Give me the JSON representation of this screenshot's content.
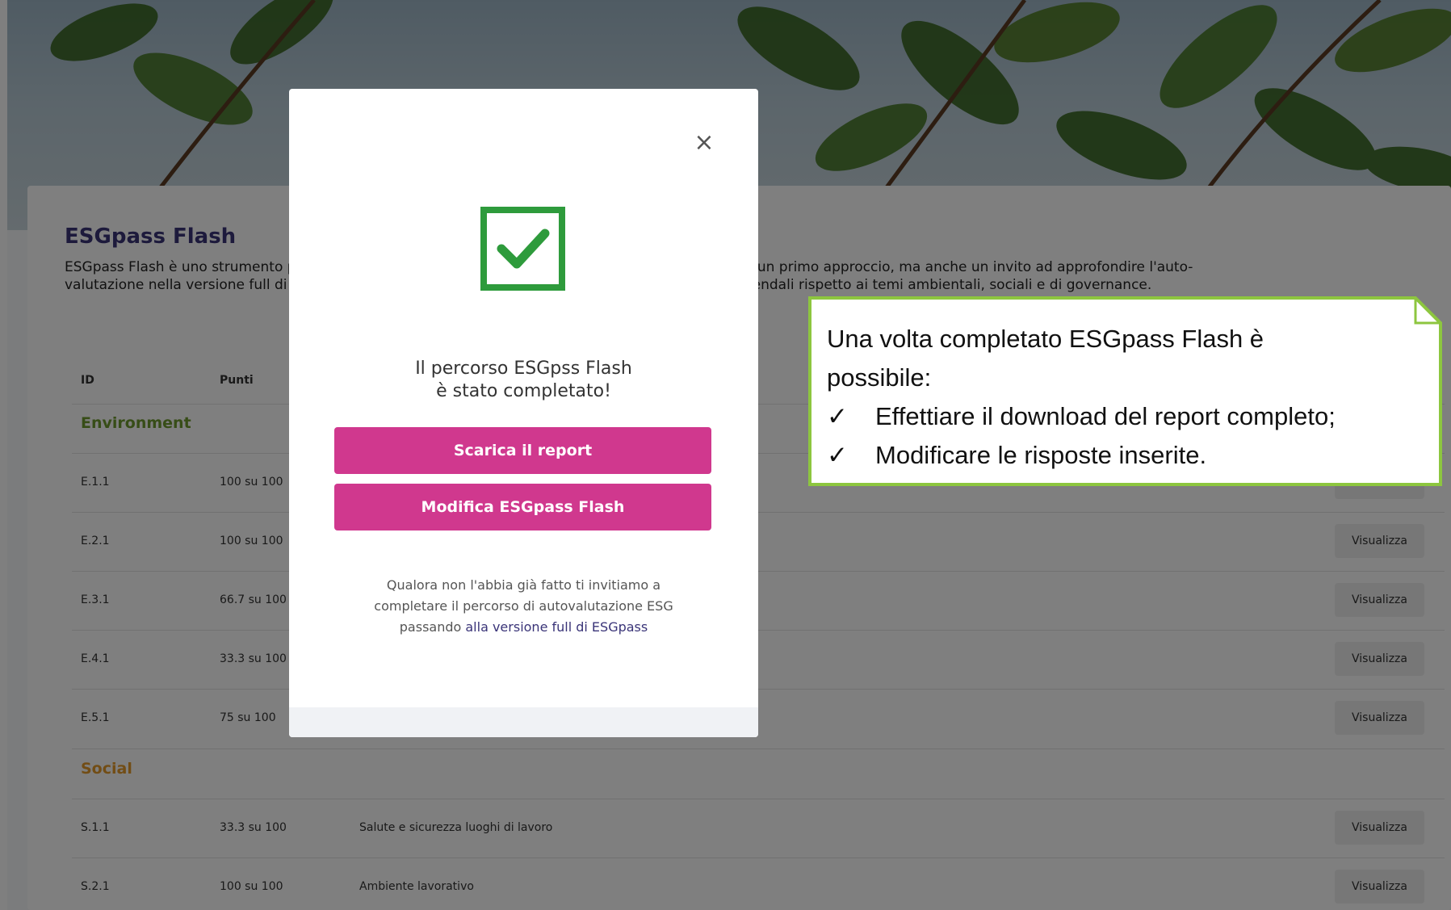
{
  "page": {
    "title": "ESGpass Flash",
    "description_line1": "ESGpass Flash è uno strumento pensato per introdurre l'azienda alle tematiche della sostenibilità. È un primo approccio, ma anche un invito ad approfondire l'auto-",
    "description_line2": "valutazione nella versione full di ESGpass, utile per analizzare in modo completo le performance aziendali rispetto ai temi ambientali, sociali e di governance."
  },
  "table": {
    "headers": {
      "id": "ID",
      "points": "Punti"
    },
    "sections": [
      {
        "label": "Environment",
        "color": "#6f9a2f"
      },
      {
        "label": "Social",
        "color": "#e59a2a"
      }
    ],
    "env_rows": [
      {
        "id": "E.1.1",
        "points": "100 su 100",
        "name": "",
        "action": "Visualizza"
      },
      {
        "id": "E.2.1",
        "points": "100 su 100",
        "name": "",
        "action": "Visualizza"
      },
      {
        "id": "E.3.1",
        "points": "66.7 su 100",
        "name": "",
        "action": "Visualizza"
      },
      {
        "id": "E.4.1",
        "points": "33.3 su 100",
        "name": "",
        "action": "Visualizza"
      },
      {
        "id": "E.5.1",
        "points": "75 su 100",
        "name": "",
        "action": "Visualizza"
      }
    ],
    "social_rows": [
      {
        "id": "S.1.1",
        "points": "33.3 su 100",
        "name": "Salute e sicurezza luoghi di lavoro",
        "action": "Visualizza"
      },
      {
        "id": "S.2.1",
        "points": "100 su 100",
        "name": "Ambiente lavorativo",
        "action": "Visualizza"
      }
    ]
  },
  "modal": {
    "close_label": "×",
    "heading_line1": "Il percorso ESGpss Flash",
    "heading_line2": "è stato completato!",
    "download_button": "Scarica il report",
    "edit_button": "Modifica ESGpass Flash",
    "note_line1": "Qualora non l'abbia già fatto ti invitiamo a",
    "note_line2": "completare il percorso di autovalutazione ESG",
    "note_line3_prefix": "passando ",
    "note_link": "alla versione full di ESGpass",
    "success_color": "#2e9b3c",
    "button_color": "#d0388e"
  },
  "callout": {
    "line1": "Una volta completato ESGpass Flash è",
    "line2": "possibile:",
    "bullet_symbol": "✓",
    "bullet1": "Effettiare il download del report completo;",
    "bullet2": "Modificare le risposte inserite.",
    "border_color": "#8dc63f"
  }
}
